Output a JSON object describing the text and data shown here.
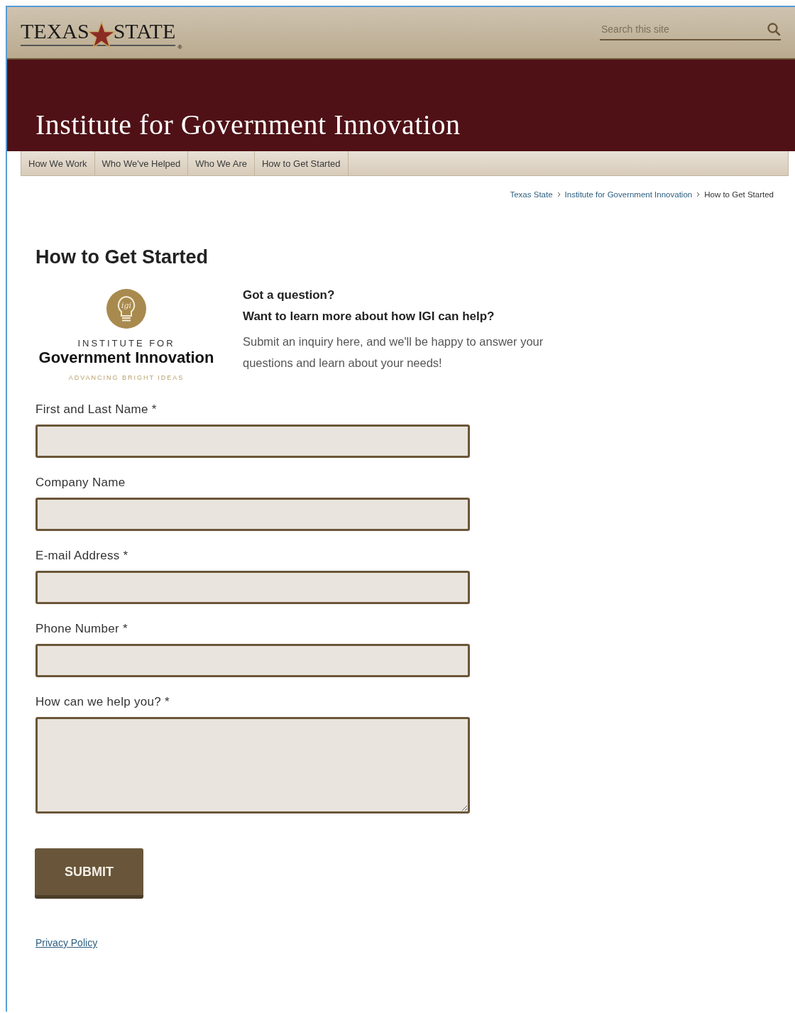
{
  "header": {
    "logo": {
      "left": "TEXAS",
      "right": "STATE",
      "mark": "®"
    },
    "search": {
      "placeholder": "Search this site"
    }
  },
  "banner": {
    "title": "Institute for Government Innovation"
  },
  "nav": [
    {
      "label": "How We Work"
    },
    {
      "label": "Who We've Helped"
    },
    {
      "label": "Who We Are"
    },
    {
      "label": "How to Get Started"
    }
  ],
  "breadcrumb": [
    {
      "label": "Texas State",
      "link": true
    },
    {
      "label": "Institute for Government Innovation",
      "link": true
    },
    {
      "label": "How to Get Started",
      "link": false
    }
  ],
  "page_title": "How to Get Started",
  "intro": {
    "logo": {
      "mark": "igi",
      "line_1": "INSTITUTE FOR",
      "line_2": "Government Innovation",
      "tagline": "ADVANCING BRIGHT IDEAS"
    },
    "question_1": "Got a question?",
    "question_2": "Want to learn more about how IGI can help?",
    "text": "Submit an inquiry here, and we'll be happy to answer your questions and learn about your needs!"
  },
  "form": {
    "fields": [
      {
        "label": "First and Last Name *",
        "kind": "input"
      },
      {
        "label": "Company Name",
        "kind": "input"
      },
      {
        "label": "E-mail Address *",
        "kind": "input"
      },
      {
        "label": "Phone Number *",
        "kind": "input"
      },
      {
        "label": "How can we help you? *",
        "kind": "textarea"
      }
    ],
    "submit": "SUBMIT"
  },
  "footer": {
    "link": "Privacy Policy"
  }
}
